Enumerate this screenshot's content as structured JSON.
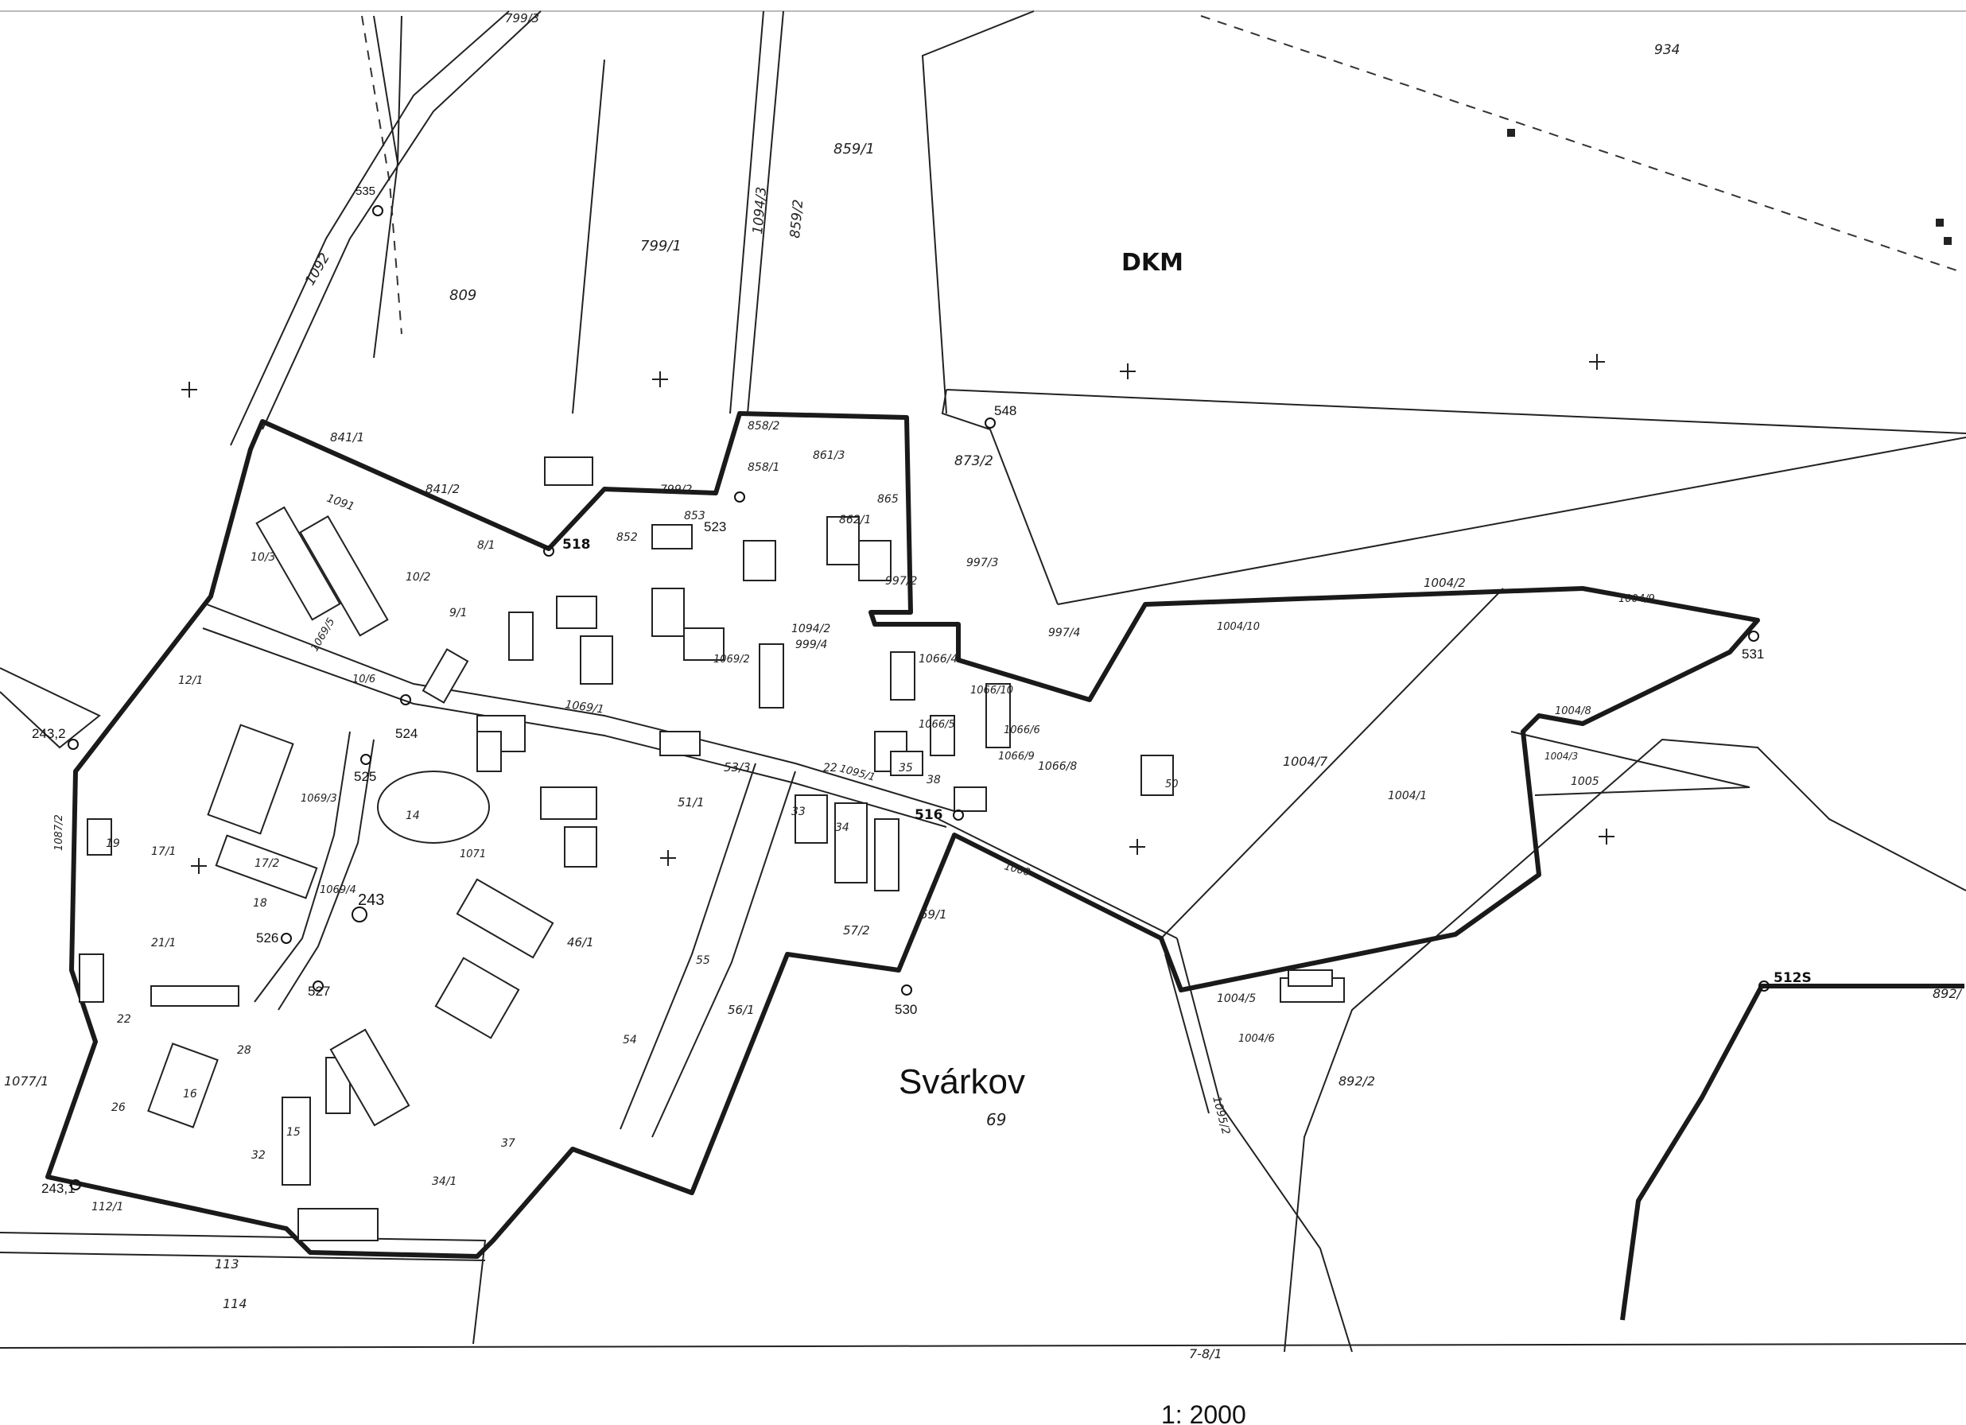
{
  "map": {
    "title": "Svárkov",
    "title_number": "69",
    "scale": "1: 2000",
    "sheet": "7-8/1",
    "region_mark": "DKM",
    "parcels": [
      {
        "id": "p934",
        "text": "934"
      },
      {
        "id": "p799-3",
        "text": "799/3"
      },
      {
        "id": "p799-1",
        "text": "799/1"
      },
      {
        "id": "p809",
        "text": "809"
      },
      {
        "id": "p859-1",
        "text": "859/1"
      },
      {
        "id": "p1094-3",
        "text": "1094/3"
      },
      {
        "id": "p859-2",
        "text": "859/2"
      },
      {
        "id": "p1092",
        "text": "1092"
      },
      {
        "id": "p841-1",
        "text": "841/1"
      },
      {
        "id": "p841-2",
        "text": "841/2"
      },
      {
        "id": "p1091",
        "text": "1091"
      },
      {
        "id": "p858-2",
        "text": "858/2"
      },
      {
        "id": "p858-1",
        "text": "858/1"
      },
      {
        "id": "p861-3",
        "text": "861/3"
      },
      {
        "id": "p865",
        "text": "865"
      },
      {
        "id": "p873-2",
        "text": "873/2"
      },
      {
        "id": "p862-1",
        "text": "862/1"
      },
      {
        "id": "p853",
        "text": "853"
      },
      {
        "id": "p852",
        "text": "852"
      },
      {
        "id": "p799-2",
        "text": "799/2"
      },
      {
        "id": "p997-3",
        "text": "997/3"
      },
      {
        "id": "p997-2",
        "text": "997/2"
      },
      {
        "id": "p997-4",
        "text": "997/4"
      },
      {
        "id": "p1004-2",
        "text": "1004/2"
      },
      {
        "id": "p1004-9",
        "text": "1004/9"
      },
      {
        "id": "p1004-10",
        "text": "1004/10"
      },
      {
        "id": "p1094-2",
        "text": "1094/2"
      },
      {
        "id": "p999-4",
        "text": "999/4"
      },
      {
        "id": "p1066-4",
        "text": "1066/4"
      },
      {
        "id": "p1066-10",
        "text": "1066/10"
      },
      {
        "id": "p1066-5",
        "text": "1066/5"
      },
      {
        "id": "p1066-6",
        "text": "1066/6"
      },
      {
        "id": "p1066-9",
        "text": "1066/9"
      },
      {
        "id": "p1066-8",
        "text": "1066/8"
      },
      {
        "id": "p1004-7",
        "text": "1004/7"
      },
      {
        "id": "p1004-1",
        "text": "1004/1"
      },
      {
        "id": "p1004-8",
        "text": "1004/8"
      },
      {
        "id": "p1004-3",
        "text": "1004/3"
      },
      {
        "id": "p1005",
        "text": "1005"
      },
      {
        "id": "p50",
        "text": "50"
      },
      {
        "id": "p1069-1",
        "text": "1069/1"
      },
      {
        "id": "p1069-2",
        "text": "1069/2"
      },
      {
        "id": "p1069-3",
        "text": "1069/3"
      },
      {
        "id": "p1069-4",
        "text": "1069/4"
      },
      {
        "id": "p1069-5",
        "text": "1069/5"
      },
      {
        "id": "p1071",
        "text": "1071"
      },
      {
        "id": "p1095-1",
        "text": "1095/1"
      },
      {
        "id": "p1095-2",
        "text": "1095/2"
      },
      {
        "id": "p1000",
        "text": "1000"
      },
      {
        "id": "p1087-2",
        "text": "1087/2"
      },
      {
        "id": "p1077-1",
        "text": "1077/1"
      },
      {
        "id": "p112-1",
        "text": "112/1"
      },
      {
        "id": "p113",
        "text": "113"
      },
      {
        "id": "p114",
        "text": "114"
      },
      {
        "id": "p12-1",
        "text": "12/1"
      },
      {
        "id": "p19",
        "text": "19"
      },
      {
        "id": "p17-1",
        "text": "17/1"
      },
      {
        "id": "p17-2",
        "text": "17/2"
      },
      {
        "id": "p18",
        "text": "18"
      },
      {
        "id": "p21-1",
        "text": "21/1"
      },
      {
        "id": "p22",
        "text": "22"
      },
      {
        "id": "p26",
        "text": "26"
      },
      {
        "id": "p28",
        "text": "28"
      },
      {
        "id": "p32",
        "text": "32"
      },
      {
        "id": "p16",
        "text": "16"
      },
      {
        "id": "p15",
        "text": "15"
      },
      {
        "id": "p34-1",
        "text": "34/1"
      },
      {
        "id": "p37",
        "text": "37"
      },
      {
        "id": "p46-1",
        "text": "46/1"
      },
      {
        "id": "p51-1",
        "text": "51/1"
      },
      {
        "id": "p53-3",
        "text": "53/3"
      },
      {
        "id": "p55",
        "text": "55"
      },
      {
        "id": "p56-1",
        "text": "56/1"
      },
      {
        "id": "p54",
        "text": "54"
      },
      {
        "id": "p57-2",
        "text": "57/2"
      },
      {
        "id": "p59-1",
        "text": "59/1"
      },
      {
        "id": "p10-3",
        "text": "10/3"
      },
      {
        "id": "p10-2",
        "text": "10/2"
      },
      {
        "id": "p9-1",
        "text": "9/1"
      },
      {
        "id": "p8-1",
        "text": "8/1"
      },
      {
        "id": "p10-6",
        "text": "10/6"
      },
      {
        "id": "p1004-5",
        "text": "1004/5"
      },
      {
        "id": "p1004-6",
        "text": "1004/6"
      },
      {
        "id": "p892-2",
        "text": "892/2"
      },
      {
        "id": "p892-1",
        "text": "892/"
      },
      {
        "id": "p33",
        "text": "33"
      },
      {
        "id": "p34",
        "text": "34"
      },
      {
        "id": "p35",
        "text": "35"
      },
      {
        "id": "p38",
        "text": "38"
      },
      {
        "id": "p22b",
        "text": "22"
      },
      {
        "id": "p14",
        "text": "14"
      }
    ],
    "points": [
      {
        "id": "pt518",
        "text": "518"
      },
      {
        "id": "pt516",
        "text": "516"
      },
      {
        "id": "pt530",
        "text": "530"
      },
      {
        "id": "pt531",
        "text": "531"
      },
      {
        "id": "pt512s",
        "text": "512S"
      },
      {
        "id": "pt523",
        "text": "523"
      },
      {
        "id": "pt524",
        "text": "524"
      },
      {
        "id": "pt525",
        "text": "525"
      },
      {
        "id": "pt526",
        "text": "526"
      },
      {
        "id": "pt527",
        "text": "527"
      },
      {
        "id": "pt243",
        "text": "243"
      },
      {
        "id": "pt243-2",
        "text": "243,2"
      },
      {
        "id": "pt243-1",
        "text": "243,1"
      },
      {
        "id": "pt548",
        "text": "548"
      },
      {
        "id": "pt535",
        "text": "535"
      }
    ]
  }
}
